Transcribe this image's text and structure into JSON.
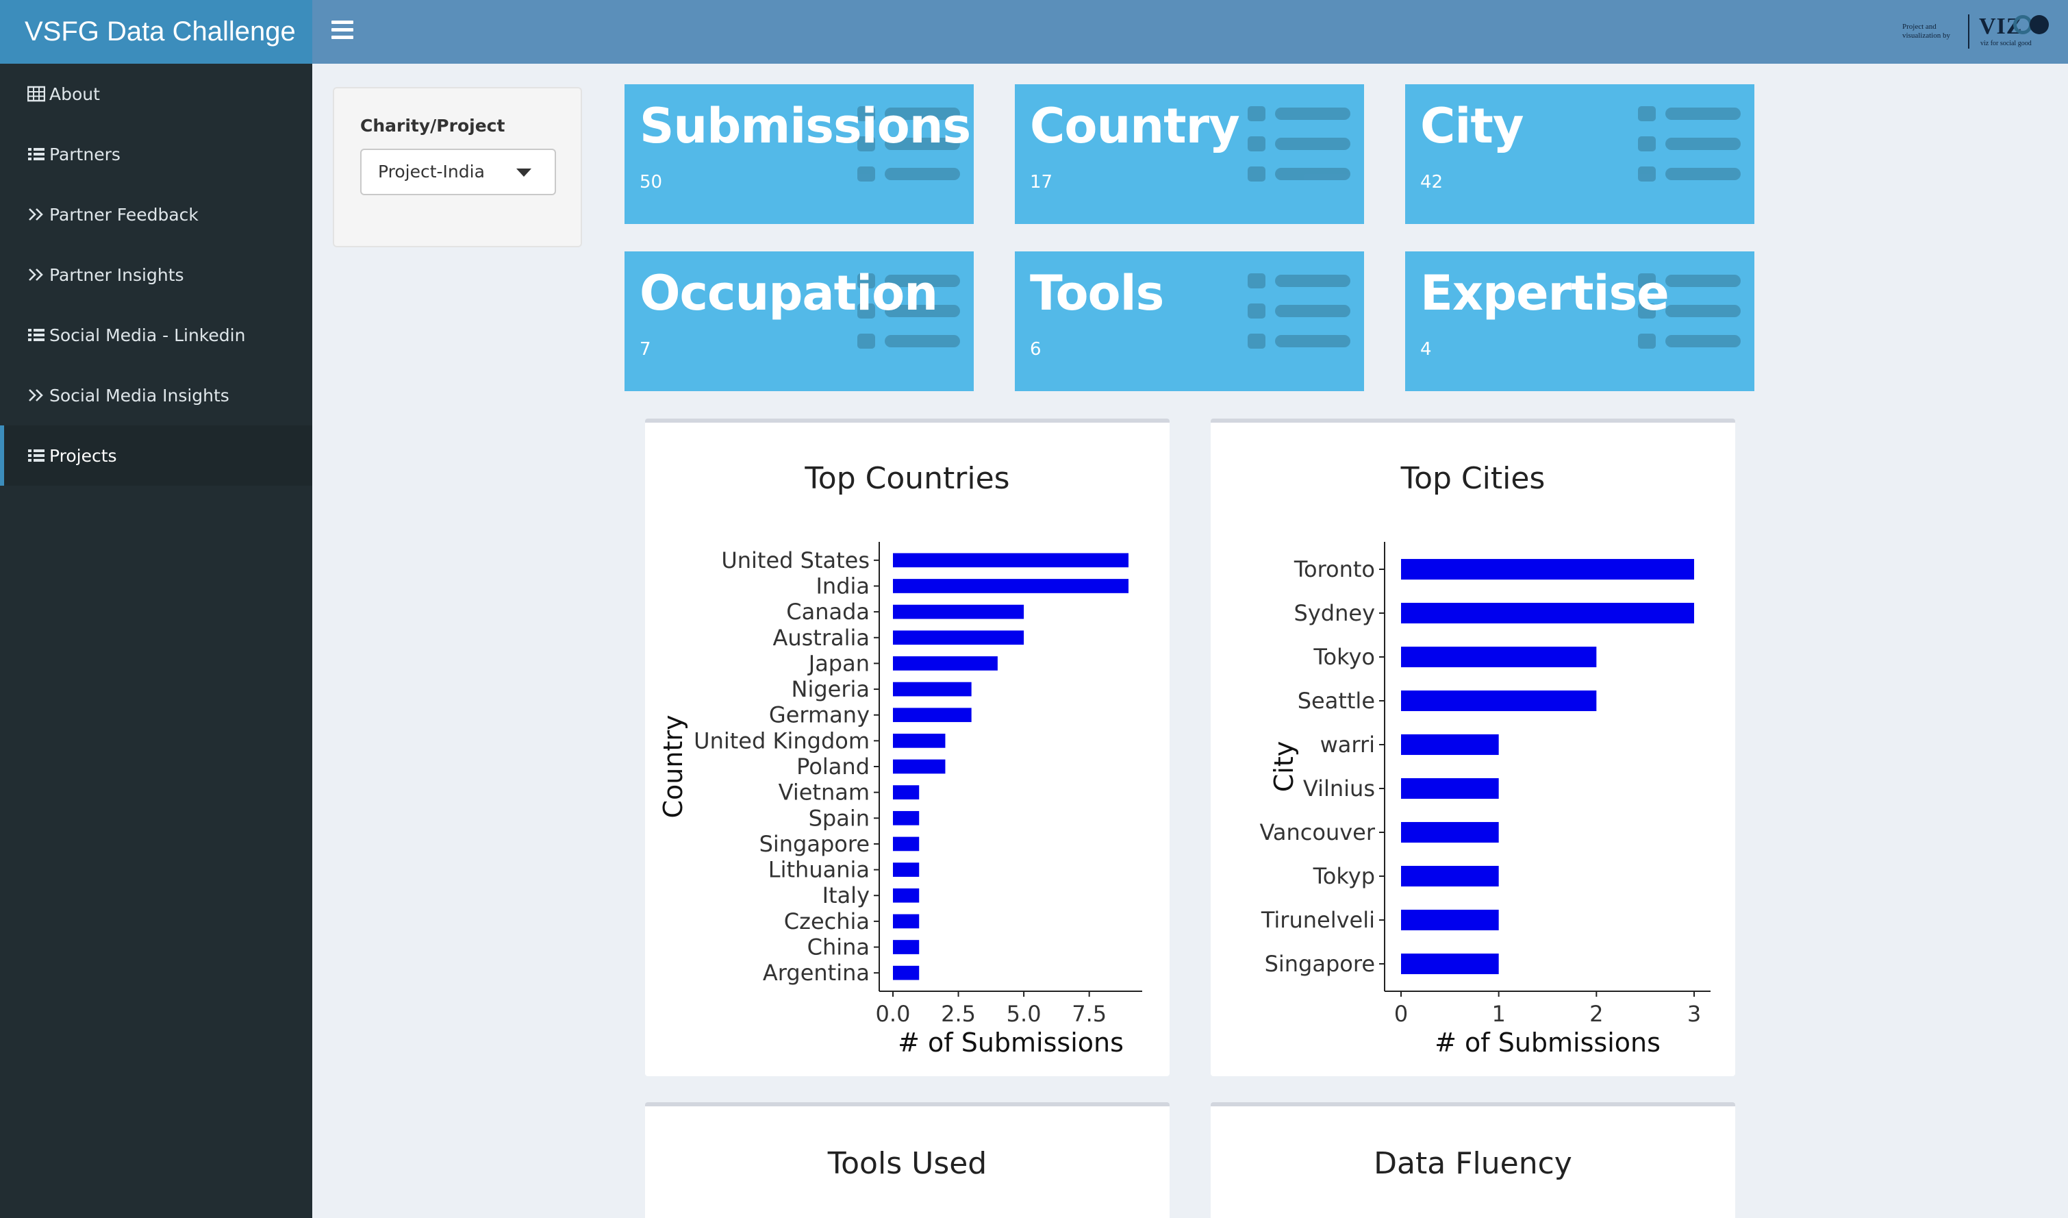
{
  "app": {
    "title": "VSFG Data Challenge",
    "brand_credit_line1": "Project and",
    "brand_credit_line2": "visualization by",
    "brand_mark": "VIZ",
    "brand_tagline": "viz for social good"
  },
  "sidebar": {
    "items": [
      {
        "label": "About",
        "icon": "table-icon"
      },
      {
        "label": "Partners",
        "icon": "list-icon"
      },
      {
        "label": "Partner Feedback",
        "icon": "double-chevron-icon"
      },
      {
        "label": "Partner Insights",
        "icon": "double-chevron-icon"
      },
      {
        "label": "Social Media - Linkedin",
        "icon": "list-icon"
      },
      {
        "label": "Social Media Insights",
        "icon": "double-chevron-icon"
      },
      {
        "label": "Projects",
        "icon": "list-icon",
        "active": true
      }
    ]
  },
  "filter": {
    "label": "Charity/Project",
    "selected": "Project-India"
  },
  "value_boxes": [
    {
      "title": "Submissions",
      "value": "50"
    },
    {
      "title": "Country",
      "value": "17"
    },
    {
      "title": "City",
      "value": "42"
    },
    {
      "title": "Occupation",
      "value": "7"
    },
    {
      "title": "Tools",
      "value": "6"
    },
    {
      "title": "Expertise",
      "value": "4"
    }
  ],
  "colors": {
    "header": "#5b8fba",
    "logo_bar": "#3c8dbc",
    "sidebar": "#222d32",
    "value_box": "#53b9e8",
    "bar": "#0000ee"
  },
  "panels": {
    "tools_title": "Tools Used",
    "fluency_title": "Data Fluency"
  },
  "chart_data": [
    {
      "type": "bar",
      "orientation": "horizontal",
      "title": "Top Countries",
      "xlabel": "# of Submissions",
      "ylabel": "Country",
      "xlim": [
        0,
        9
      ],
      "xticks": [
        "0.0",
        "2.5",
        "5.0",
        "7.5"
      ],
      "categories": [
        "United States",
        "India",
        "Canada",
        "Australia",
        "Japan",
        "Nigeria",
        "Germany",
        "United Kingdom",
        "Poland",
        "Vietnam",
        "Spain",
        "Singapore",
        "Lithuania",
        "Italy",
        "Czechia",
        "China",
        "Argentina"
      ],
      "values": [
        9,
        9,
        5,
        5,
        4,
        3,
        3,
        2,
        2,
        1,
        1,
        1,
        1,
        1,
        1,
        1,
        1
      ]
    },
    {
      "type": "bar",
      "orientation": "horizontal",
      "title": "Top Cities",
      "xlabel": "# of Submissions",
      "ylabel": "City",
      "xlim": [
        0,
        3
      ],
      "xticks": [
        "0",
        "1",
        "2",
        "3"
      ],
      "categories": [
        "Toronto",
        "Sydney",
        "Tokyo",
        "Seattle",
        "warri",
        "Vilnius",
        "Vancouver",
        "Tokyp",
        "Tirunelveli",
        "Singapore"
      ],
      "values": [
        3,
        3,
        2,
        2,
        1,
        1,
        1,
        1,
        1,
        1
      ]
    }
  ]
}
